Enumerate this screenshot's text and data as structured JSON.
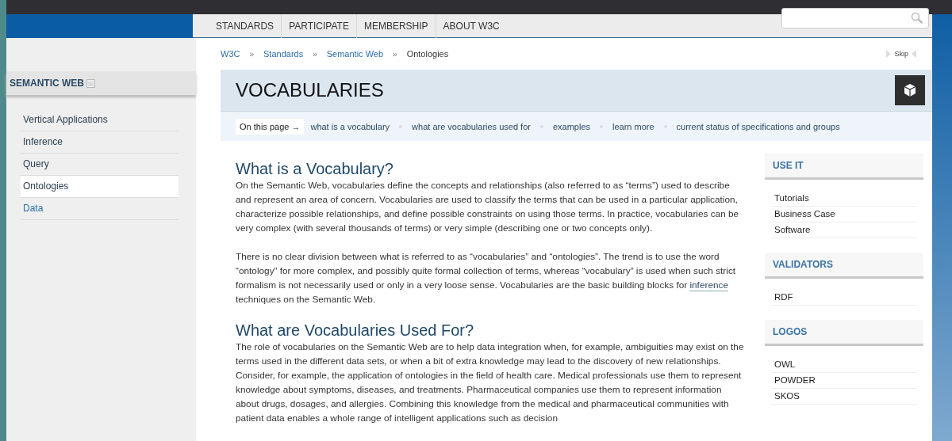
{
  "nav": {
    "items": [
      {
        "label": "STANDARDS"
      },
      {
        "label": "PARTICIPATE"
      },
      {
        "label": "MEMBERSHIP"
      },
      {
        "label": "ABOUT W3C"
      }
    ]
  },
  "sidebar": {
    "title": "SEMANTIC WEB",
    "items": [
      {
        "label": "Vertical Applications",
        "selected": false,
        "kind": "plain"
      },
      {
        "label": "Inference",
        "selected": false,
        "kind": "plain"
      },
      {
        "label": "Query",
        "selected": false,
        "kind": "plain"
      },
      {
        "label": "Ontologies",
        "selected": true,
        "kind": "plain"
      },
      {
        "label": "Data",
        "selected": false,
        "kind": "link"
      }
    ]
  },
  "breadcrumb": {
    "items": [
      {
        "label": "W3C",
        "separator": "»"
      },
      {
        "label": "Standards",
        "separator": "»"
      },
      {
        "label": "Semantic Web",
        "separator": "»"
      },
      {
        "label": "Ontologies"
      }
    ],
    "skip": "Skip"
  },
  "page_title": "VOCABULARIES",
  "on_this_page": {
    "label": "On this page →",
    "links": [
      "what is a vocabulary",
      "what are vocabularies used for",
      "examples",
      "learn more",
      "current status of specifications and groups"
    ]
  },
  "sections": [
    {
      "heading": "What is a Vocabulary?",
      "paragraphs": [
        "On the Semantic Web, vocabularies define the concepts and relationships (also referred to as “terms”) used to describe and represent an area of concern. Vocabularies are used to classify the terms that can be used in a particular application, characterize possible relationships, and define possible constraints on using those terms. In practice, vocabularies can be very complex (with several thousands of terms) or very simple (describing one or two concepts only).",
        [
          {
            "kind": "text",
            "text": "There is no clear division between what is referred to as “vocabularies” and “ontologies”. The trend is to use the word “ontology” for more complex, and possibly quite formal collection of terms, whereas “vocabulary” is used when such strict formalism is not necessarily used or only in a very loose sense. Vocabularies are the basic building blocks for "
          },
          {
            "kind": "link",
            "text": "inference"
          },
          {
            "kind": "text",
            "text": " techniques on the Semantic Web."
          }
        ]
      ]
    },
    {
      "heading": "What are Vocabularies Used For?",
      "paragraphs": [
        "The role of vocabularies on the Semantic Web are to help data integration when, for example, ambiguities may exist on the terms used in the different data sets, or when a bit of extra knowledge may lead to the discovery of new relationships. Consider, for example, the application of ontologies in the field of health care. Medical professionals use them to represent knowledge about symptoms, diseases, and treatments. Pharmaceutical companies use them to represent information about drugs, dosages, and allergies. Combining this knowledge from the medical and pharmaceutical communities with patient data enables a whole range of intelligent applications such as decision"
      ]
    }
  ],
  "right_column": [
    {
      "title": "USE IT",
      "items": [
        "Tutorials",
        "Business Case",
        "Software"
      ]
    },
    {
      "title": "VALIDATORS",
      "items": [
        "RDF"
      ]
    },
    {
      "title": "LOGOS",
      "items": [
        "OWL",
        "POWDER",
        "SKOS"
      ]
    }
  ]
}
